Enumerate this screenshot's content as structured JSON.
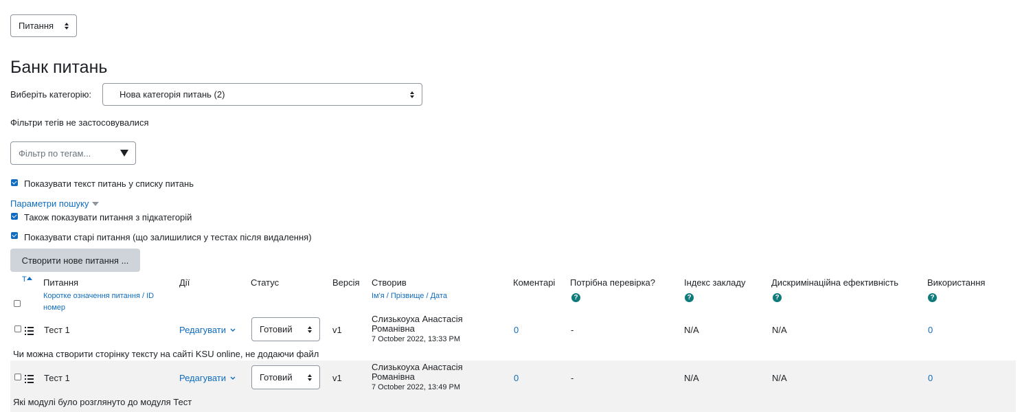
{
  "top_select": {
    "value": "Питання"
  },
  "page_title": "Банк питань",
  "category": {
    "label": "Виберіть категорію:",
    "value": "Нова категорія питань (2)"
  },
  "tag_filters_note": "Фільтри тегів не застосовувалися",
  "tag_filter": {
    "placeholder": "Фільтр по тегам..."
  },
  "show_text_checkbox": {
    "label": "Показувати текст питань у списку питань",
    "checked": true
  },
  "search_params": {
    "label": "Параметри пошуку"
  },
  "subcategories_checkbox": {
    "label": "Також показувати питання з підкатегорій",
    "checked": true
  },
  "old_questions_checkbox": {
    "label": "Показувати старі питання (що залишилися у тестах після видалення)",
    "checked": true
  },
  "create_button": {
    "label": "Створити нове питання ..."
  },
  "table": {
    "headers": {
      "type": "Т",
      "question": "Питання",
      "question_sub_1": "Коротке означення питання",
      "question_sep_1": " / ",
      "question_sub_2": "ID",
      "question_sub_3": "номер",
      "actions": "Дії",
      "status": "Статус",
      "version": "Версія",
      "creator": "Створив",
      "creator_sub_1": "Ім'я",
      "creator_sep_1": " / ",
      "creator_sub_2": "Прізвище",
      "creator_sep_2": " / ",
      "creator_sub_3": "Дата",
      "comments": "Коментарі",
      "needs_checking": "Потрібна перевірка?",
      "facility_index": "Індекс закладу",
      "discrimination": "Дискримінаційна ефективність",
      "usage": "Використання"
    },
    "rows": [
      {
        "name": "Тест 1",
        "action": "Редагувати",
        "status": "Готовий",
        "version": "v1",
        "creator_name": "Слизькоуха Анастасія Романівна",
        "creator_date": "7 October 2022, 13:33 PM",
        "comments": "0",
        "needs_checking": "-",
        "facility_index": "N/A",
        "discrimination": "N/A",
        "usage": "0",
        "question_text": "Чи можна створити сторінку тексту на сайті KSU online, не додаючи файл"
      },
      {
        "name": "Тест 1",
        "action": "Редагувати",
        "status": "Готовий",
        "version": "v1",
        "creator_name": "Слизькоуха Анастасія Романівна",
        "creator_date": "7 October 2022, 13:49 PM",
        "comments": "0",
        "needs_checking": "-",
        "facility_index": "N/A",
        "discrimination": "N/A",
        "usage": "0",
        "question_text": "Які модулі було розглянуто до модуля Тест"
      }
    ]
  },
  "colors": {
    "link": "#0f6cbf",
    "help_icon": "#0f7a7a",
    "row_alt": "#f2f2f2",
    "button_grey": "#ced4da"
  }
}
